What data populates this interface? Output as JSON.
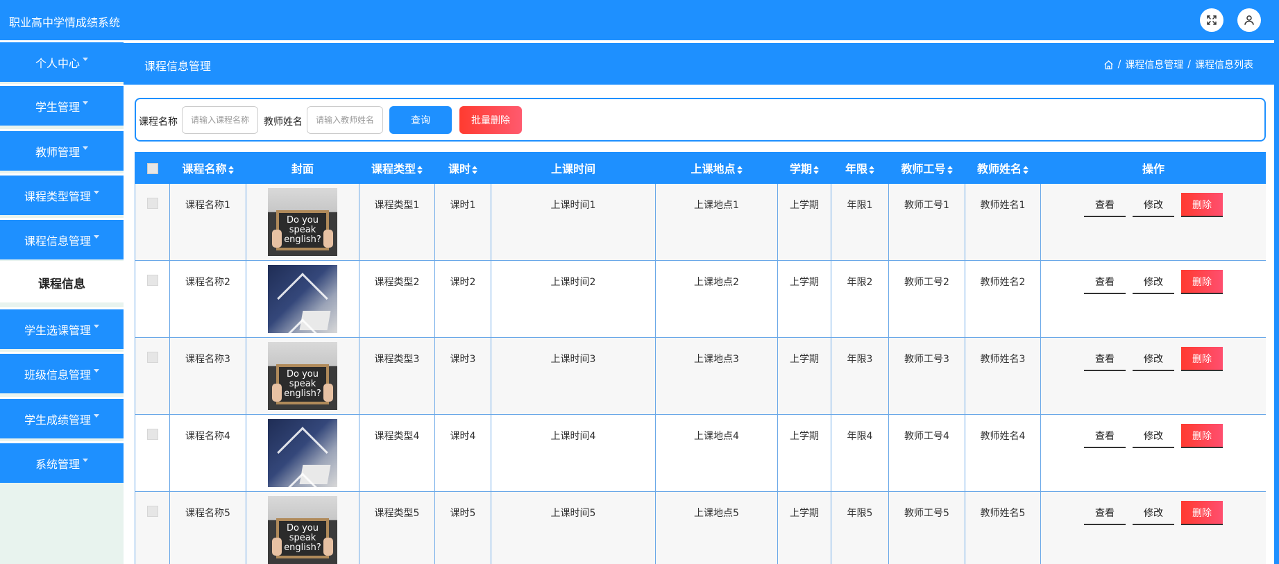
{
  "app": {
    "title": "职业高中学情成绩系统"
  },
  "header_icons": [
    "fullscreen-icon",
    "user-icon"
  ],
  "sidebar": {
    "items": [
      {
        "label": "个人中心",
        "has_caret": true
      },
      {
        "label": "学生管理",
        "has_caret": true
      },
      {
        "label": "教师管理",
        "has_caret": true
      },
      {
        "label": "课程类型管理",
        "has_caret": true
      },
      {
        "label": "课程信息管理",
        "has_caret": true
      },
      {
        "label": "课程信息",
        "has_caret": false,
        "active": true
      },
      {
        "label": "学生选课管理",
        "has_caret": true
      },
      {
        "label": "班级信息管理",
        "has_caret": true
      },
      {
        "label": "学生成绩管理",
        "has_caret": true
      },
      {
        "label": "系统管理",
        "has_caret": true
      }
    ]
  },
  "page": {
    "title": "课程信息管理",
    "breadcrumb": [
      "课程信息管理",
      "课程信息列表"
    ],
    "breadcrumb_sep": "/"
  },
  "search": {
    "course_label": "课程名称",
    "course_placeholder": "请输入课程名称",
    "teacher_label": "教师姓名",
    "teacher_placeholder": "请输入教师姓名",
    "query_label": "查询",
    "batch_delete_label": "批量删除"
  },
  "table": {
    "columns": [
      "课程名称",
      "封面",
      "课程类型",
      "课时",
      "上课时间",
      "上课地点",
      "学期",
      "年限",
      "教师工号",
      "教师姓名",
      "操作"
    ],
    "sortable": [
      true,
      false,
      true,
      true,
      false,
      true,
      true,
      true,
      true,
      true,
      false
    ],
    "rows": [
      {
        "name": "课程名称1",
        "cover": "cover-speak-english",
        "type": "课程类型1",
        "hours": "课时1",
        "time": "上课时间1",
        "place": "上课地点1",
        "term": "上学期",
        "years": "年限1",
        "teacher_no": "教师工号1",
        "teacher_name": "教师姓名1"
      },
      {
        "name": "课程名称2",
        "cover": "cover-student-writing",
        "type": "课程类型2",
        "hours": "课时2",
        "time": "上课时间2",
        "place": "上课地点2",
        "term": "上学期",
        "years": "年限2",
        "teacher_no": "教师工号2",
        "teacher_name": "教师姓名2"
      },
      {
        "name": "课程名称3",
        "cover": "cover-speak-english",
        "type": "课程类型3",
        "hours": "课时3",
        "time": "上课时间3",
        "place": "上课地点3",
        "term": "上学期",
        "years": "年限3",
        "teacher_no": "教师工号3",
        "teacher_name": "教师姓名3"
      },
      {
        "name": "课程名称4",
        "cover": "cover-student-writing",
        "type": "课程类型4",
        "hours": "课时4",
        "time": "上课时间4",
        "place": "上课地点4",
        "term": "上学期",
        "years": "年限4",
        "teacher_no": "教师工号4",
        "teacher_name": "教师姓名4"
      },
      {
        "name": "课程名称5",
        "cover": "cover-speak-english",
        "type": "课程类型5",
        "hours": "课时5",
        "time": "上课时间5",
        "place": "上课地点5",
        "term": "上学期",
        "years": "年限5",
        "teacher_no": "教师工号5",
        "teacher_name": "教师姓名5"
      }
    ],
    "actions": {
      "view": "查看",
      "edit": "修改",
      "delete": "删除"
    }
  },
  "colors": {
    "primary": "#1e90ff",
    "danger": "#ff3b30",
    "sidebar_bg": "#e8f3ee"
  }
}
